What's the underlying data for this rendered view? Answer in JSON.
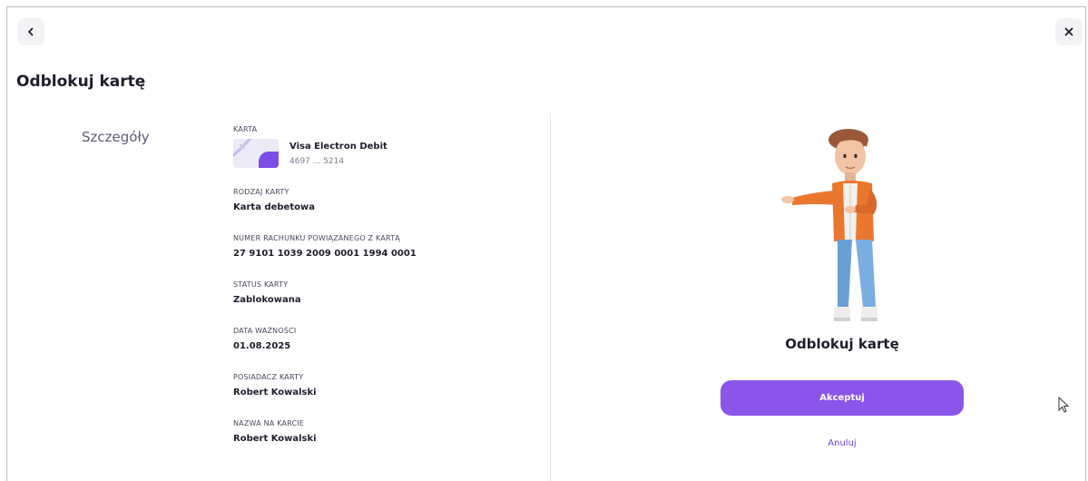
{
  "header": {
    "back_icon": "chevron-left-icon",
    "close_icon": "close-icon",
    "page_title": "Odblokuj kartę"
  },
  "details": {
    "section_label": "Szczegóły",
    "card": {
      "label": "KARTA",
      "name": "Visa Electron Debit",
      "number": "4697 ... 5214"
    },
    "fields": [
      {
        "label": "RODZAJ KARTY",
        "value": "Karta debetowa"
      },
      {
        "label": "NUMER RACHUNKU POWIĄZANEGO Z KARTĄ",
        "value": "27 9101 1039 2009 0001 1994 0001"
      },
      {
        "label": "STATUS KARTY",
        "value": "Zablokowana"
      },
      {
        "label": "DATA WAŻNOŚCI",
        "value": "01.08.2025"
      },
      {
        "label": "POSIADACZ KARTY",
        "value": "Robert Kowalski"
      },
      {
        "label": "NAZWA NA KARCIE",
        "value": "Robert Kowalski"
      }
    ]
  },
  "panel": {
    "title": "Odblokuj kartę",
    "accept_label": "Akceptuj",
    "cancel_label": "Anuluj"
  },
  "colors": {
    "accent": "#8a55e8",
    "link": "#6a40d8",
    "card_purple": "#7b4ee6"
  }
}
